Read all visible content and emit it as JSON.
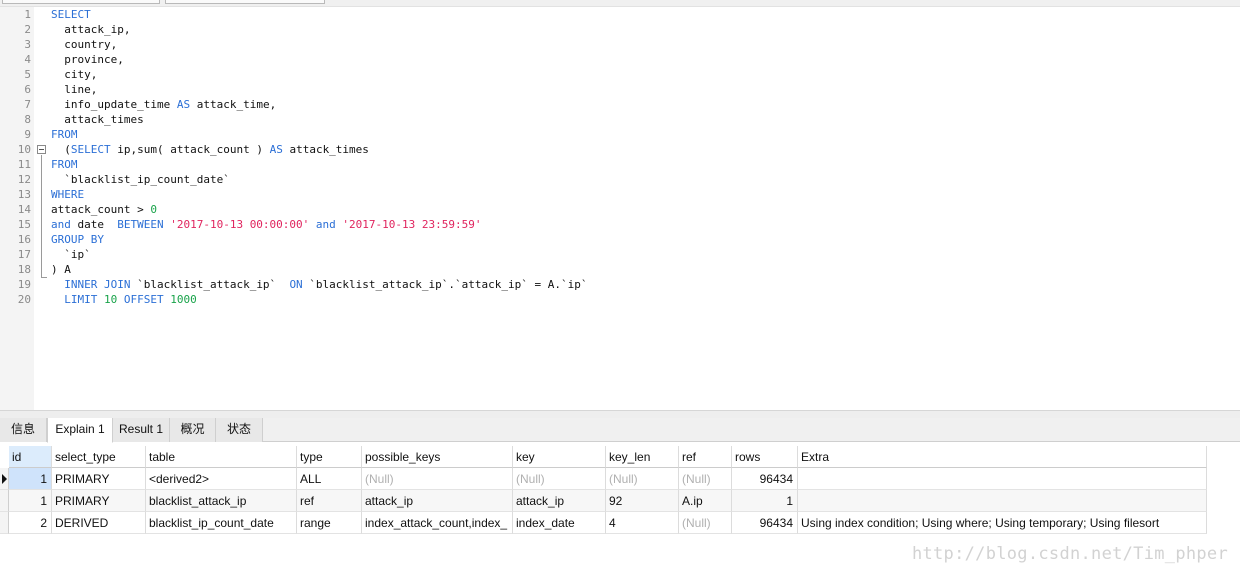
{
  "editor": {
    "lines": [
      {
        "num": "1",
        "tokens": [
          {
            "t": "SELECT",
            "c": "kw"
          }
        ]
      },
      {
        "num": "2",
        "tokens": [
          {
            "t": "  attack_ip,",
            "c": ""
          }
        ]
      },
      {
        "num": "3",
        "tokens": [
          {
            "t": "  country,",
            "c": ""
          }
        ]
      },
      {
        "num": "4",
        "tokens": [
          {
            "t": "  province,",
            "c": ""
          }
        ]
      },
      {
        "num": "5",
        "tokens": [
          {
            "t": "  city,",
            "c": ""
          }
        ]
      },
      {
        "num": "6",
        "tokens": [
          {
            "t": "  line,",
            "c": ""
          }
        ]
      },
      {
        "num": "7",
        "tokens": [
          {
            "t": "  info_update_time ",
            "c": ""
          },
          {
            "t": "AS",
            "c": "kw"
          },
          {
            "t": " attack_time,",
            "c": ""
          }
        ]
      },
      {
        "num": "8",
        "tokens": [
          {
            "t": "  attack_times",
            "c": ""
          }
        ]
      },
      {
        "num": "9",
        "tokens": [
          {
            "t": "FROM",
            "c": "kw"
          }
        ]
      },
      {
        "num": "10",
        "tokens": [
          {
            "t": "  (",
            "c": ""
          },
          {
            "t": "SELECT",
            "c": "kw"
          },
          {
            "t": " ip,sum( attack_count ) ",
            "c": ""
          },
          {
            "t": "AS",
            "c": "kw"
          },
          {
            "t": " attack_times",
            "c": ""
          }
        ]
      },
      {
        "num": "11",
        "tokens": [
          {
            "t": "FROM",
            "c": "kw"
          }
        ]
      },
      {
        "num": "12",
        "tokens": [
          {
            "t": "  `blacklist_ip_count_date`",
            "c": ""
          }
        ]
      },
      {
        "num": "13",
        "tokens": [
          {
            "t": "WHERE",
            "c": "kw"
          }
        ]
      },
      {
        "num": "14",
        "tokens": [
          {
            "t": "attack_count > ",
            "c": ""
          },
          {
            "t": "0",
            "c": "num"
          }
        ]
      },
      {
        "num": "15",
        "tokens": [
          {
            "t": "and",
            "c": "kw"
          },
          {
            "t": " date  ",
            "c": ""
          },
          {
            "t": "BETWEEN",
            "c": "kw"
          },
          {
            "t": " ",
            "c": ""
          },
          {
            "t": "'2017-10-13 00:00:00'",
            "c": "str"
          },
          {
            "t": " ",
            "c": ""
          },
          {
            "t": "and",
            "c": "kw"
          },
          {
            "t": " ",
            "c": ""
          },
          {
            "t": "'2017-10-13 23:59:59'",
            "c": "str"
          }
        ]
      },
      {
        "num": "16",
        "tokens": [
          {
            "t": "GROUP BY",
            "c": "kw"
          }
        ]
      },
      {
        "num": "17",
        "tokens": [
          {
            "t": "  `ip`",
            "c": ""
          }
        ]
      },
      {
        "num": "18",
        "tokens": [
          {
            "t": ") A",
            "c": ""
          }
        ]
      },
      {
        "num": "19",
        "tokens": [
          {
            "t": "  ",
            "c": ""
          },
          {
            "t": "INNER JOIN",
            "c": "kw"
          },
          {
            "t": " `blacklist_attack_ip`  ",
            "c": ""
          },
          {
            "t": "ON",
            "c": "kw"
          },
          {
            "t": " `blacklist_attack_ip`.`attack_ip` = A.`ip`",
            "c": ""
          }
        ]
      },
      {
        "num": "20",
        "tokens": [
          {
            "t": "  ",
            "c": ""
          },
          {
            "t": "LIMIT",
            "c": "kw"
          },
          {
            "t": " ",
            "c": ""
          },
          {
            "t": "10",
            "c": "num"
          },
          {
            "t": " ",
            "c": ""
          },
          {
            "t": "OFFSET",
            "c": "kw"
          },
          {
            "t": " ",
            "c": ""
          },
          {
            "t": "1000",
            "c": "num"
          }
        ]
      }
    ]
  },
  "result_tabs": [
    "信息",
    "Explain 1",
    "Result 1",
    "概况",
    "状态"
  ],
  "explain": {
    "columns": [
      "id",
      "select_type",
      "table",
      "type",
      "possible_keys",
      "key",
      "key_len",
      "ref",
      "rows",
      "Extra"
    ],
    "rows": [
      [
        "1",
        "PRIMARY",
        "<derived2>",
        "ALL",
        "(Null)",
        "(Null)",
        "(Null)",
        "(Null)",
        "96434",
        ""
      ],
      [
        "1",
        "PRIMARY",
        "blacklist_attack_ip",
        "ref",
        "attack_ip",
        "attack_ip",
        "92",
        "A.ip",
        "1",
        ""
      ],
      [
        "2",
        "DERIVED",
        "blacklist_ip_count_date",
        "range",
        "index_attack_count,index_",
        "index_date",
        "4",
        "(Null)",
        "96434",
        "Using index condition; Using where; Using temporary; Using filesort"
      ]
    ]
  },
  "watermark": "http://blog.csdn.net/Tim_phper",
  "colors": {
    "keyword": "#2b6fd6",
    "string": "#e0245e",
    "number": "#19a34a",
    "null": "#b0b0b0"
  }
}
